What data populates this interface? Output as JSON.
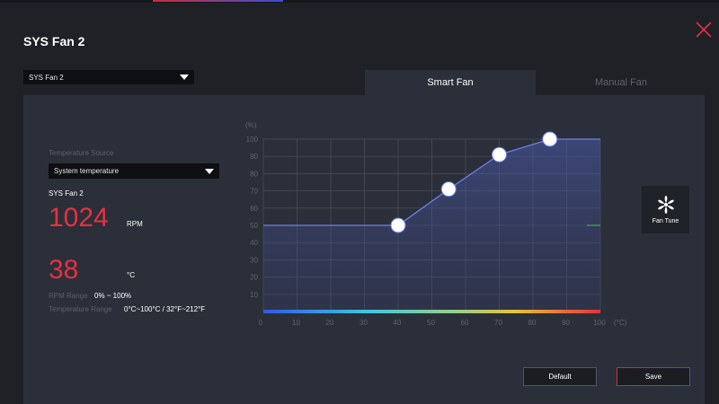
{
  "window": {
    "title": "SYS Fan 2",
    "close_icon": "close-icon"
  },
  "fan_select": {
    "value": "SYS Fan 2"
  },
  "tabs": [
    {
      "label": "Smart Fan",
      "active": true
    },
    {
      "label": "Manual Fan",
      "active": false
    }
  ],
  "left": {
    "temperature_source_label": "Temperature Source",
    "temperature_source_value": "System temperature",
    "fan_name": "SYS Fan 2",
    "rpm_value": "1024",
    "rpm_unit": "RPM",
    "temp_value": "38",
    "temp_unit": "°C",
    "rpm_range_label": "RPM Range",
    "rpm_range_value": "0% ~ 100%",
    "temp_range_label": "Temperature Range",
    "temp_range_value": "0°C~100°C / 32°F~212°F"
  },
  "fan_tune": {
    "label": "Fan Tune",
    "icon": "fan-icon"
  },
  "buttons": {
    "default": "Default",
    "save": "Save"
  },
  "colors": {
    "accent_red": "#e8303f",
    "curve": "#6d80e8",
    "panel": "#2b2f39"
  },
  "chart_data": {
    "type": "line",
    "ylabel": "(%)",
    "xlabel": "(°C)",
    "xlim": [
      0,
      100
    ],
    "ylim": [
      0,
      100
    ],
    "x_ticks": [
      0,
      10,
      20,
      30,
      40,
      50,
      60,
      70,
      80,
      90,
      100
    ],
    "y_ticks": [
      10,
      20,
      30,
      40,
      50,
      60,
      70,
      80,
      90,
      100
    ],
    "grid": true,
    "curve": [
      {
        "x": 0,
        "y": 50
      },
      {
        "x": 40,
        "y": 50
      },
      {
        "x": 55,
        "y": 71
      },
      {
        "x": 70,
        "y": 91
      },
      {
        "x": 85,
        "y": 100
      },
      {
        "x": 100,
        "y": 100
      }
    ],
    "control_points": [
      {
        "x": 40,
        "y": 50
      },
      {
        "x": 55,
        "y": 71
      },
      {
        "x": 70,
        "y": 91
      },
      {
        "x": 85,
        "y": 100
      }
    ]
  }
}
